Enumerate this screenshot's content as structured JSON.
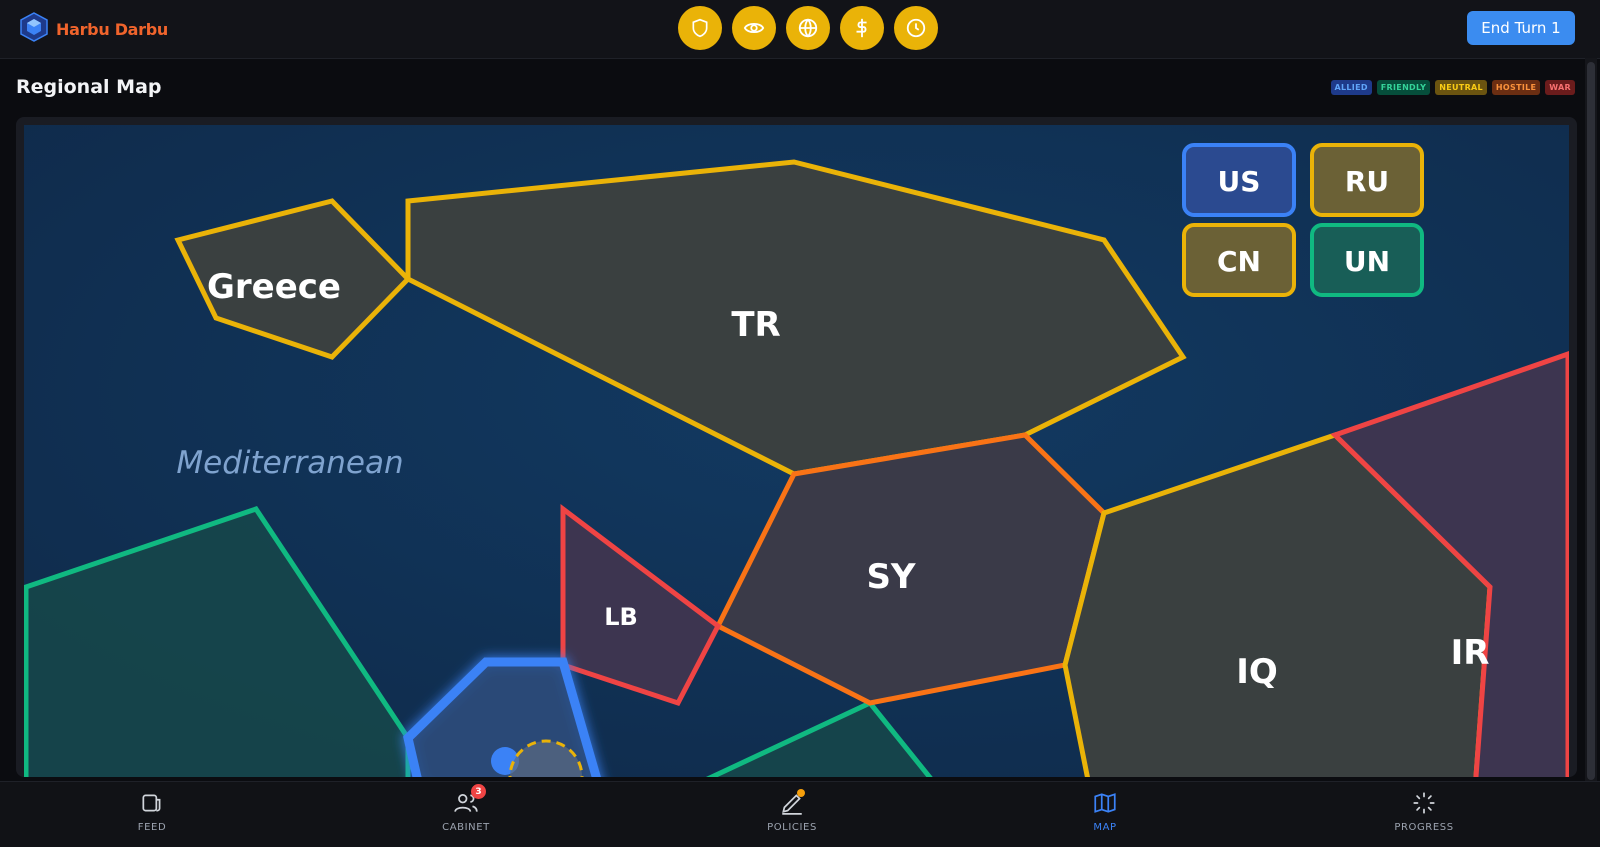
{
  "app": {
    "title": "Harbu Darbu"
  },
  "toolbar": {
    "quick_actions": [
      "shield-icon",
      "eye-icon",
      "globe-icon",
      "dollar-icon",
      "clock-icon"
    ],
    "end_turn_label": "End Turn 1"
  },
  "page": {
    "title": "Regional Map"
  },
  "legend": [
    {
      "label": "ALLIED",
      "color": "#3b82f6"
    },
    {
      "label": "FRIENDLY",
      "color": "#10b981"
    },
    {
      "label": "NEUTRAL",
      "color": "#eab308"
    },
    {
      "label": "HOSTILE",
      "color": "#f97316"
    },
    {
      "label": "WAR",
      "color": "#ef4444"
    }
  ],
  "map": {
    "sea_label": "Mediterranean",
    "countries": {
      "greece": "Greece",
      "tr": "TR",
      "sy": "SY",
      "lb": "LB",
      "iq": "IQ",
      "ir": "IR"
    },
    "factions": {
      "us": "US",
      "ru": "RU",
      "cn": "CN",
      "un": "UN"
    }
  },
  "nav": {
    "feed": "FEED",
    "cabinet": "CABINET",
    "cabinet_badge": "3",
    "policies": "POLICIES",
    "map": "MAP",
    "progress": "PROGRESS"
  },
  "colors": {
    "accent": "#3b8cf0",
    "quick_action": "#eab308",
    "brand": "#f0642c"
  }
}
